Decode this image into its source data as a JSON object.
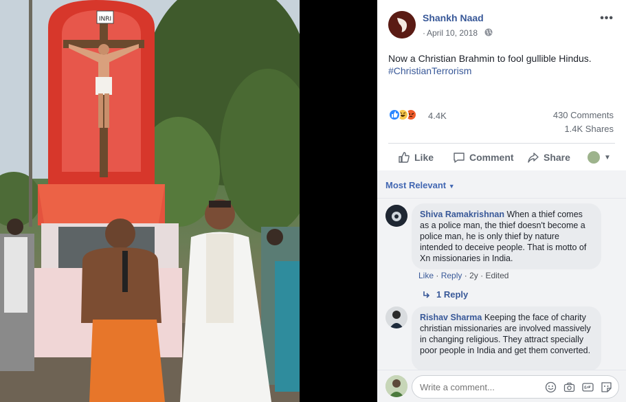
{
  "post": {
    "page_name": "Shankh Naad",
    "date": "April 10, 2018",
    "date_separator": "·",
    "more_menu": "•••",
    "text": "Now a Christian Brahmin to fool gullible Hindus.",
    "hashtag": "#ChristianTerrorism",
    "photo_sign": "INRI"
  },
  "stats": {
    "reaction_count": "4.4K",
    "comments": "430 Comments",
    "shares": "1.4K Shares"
  },
  "actions": {
    "like": "Like",
    "comment": "Comment",
    "share": "Share"
  },
  "comments_header": {
    "sort_label": "Most Relevant"
  },
  "comments": [
    {
      "author": "Shiva Ramakrishnan",
      "text": "When a thief comes as a police man, the thief doesn't become a police man, he is only thief by nature intended to deceive people. That is motto of Xn missionaries in India.",
      "like": "Like",
      "reply": "Reply",
      "age": "2y",
      "edited": "Edited",
      "meta_dot": "·",
      "replies": "1 Reply"
    },
    {
      "author": "Rishav Sharma",
      "text": "Keeping the face of charity christian missionaries are involved massively in changing religious. They attract specially poor people in India and get them converted."
    }
  ],
  "composer": {
    "placeholder": "Write a comment..."
  },
  "colors": {
    "link": "#385898",
    "like_blue": "#2d88ff",
    "haha_yellow": "#f7c74b",
    "angry_orange": "#f05c2b"
  }
}
